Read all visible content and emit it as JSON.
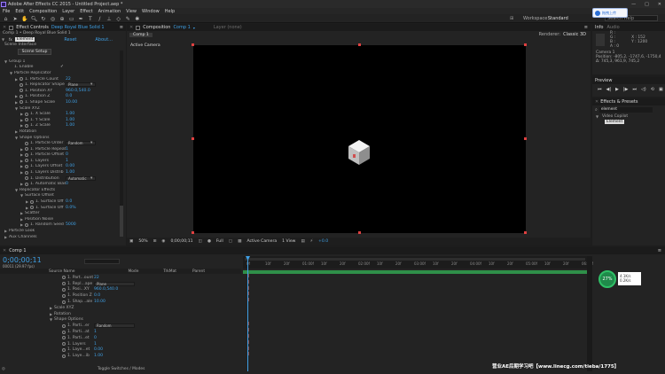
{
  "window": {
    "title": "Adobe After Effects CC 2015 - Untitled Project.aep *"
  },
  "menu": [
    "File",
    "Edit",
    "Composition",
    "Layer",
    "Effect",
    "Animation",
    "View",
    "Window",
    "Help"
  ],
  "workspace": {
    "label": "Workspace:",
    "value": "Standard"
  },
  "search_help": {
    "placeholder": "Search Help"
  },
  "baidu_popup": "拖拽上传",
  "effect_controls": {
    "tab_label": "Effect Controls",
    "tab_layer": "Deep Royal Blue Solid 1",
    "breadcrumb": "Comp 1 • Deep Royal Blue Solid 1",
    "effect_name": "Element",
    "reset": "Reset",
    "about": "About...",
    "scene_interface": "Scene Interface",
    "scene_setup": "Scene Setup",
    "rows": [
      {
        "indent": 0,
        "tri": "open",
        "label": "Group 1"
      },
      {
        "indent": 1,
        "tri": "",
        "label": "1. Enable",
        "value": "✓",
        "vtype": "check"
      },
      {
        "indent": 1,
        "tri": "open",
        "label": "Particle Replicator"
      },
      {
        "indent": 2,
        "tri": "closed",
        "stop": true,
        "label": "1. Particle Count",
        "value": "22",
        "vtype": "blue"
      },
      {
        "indent": 2,
        "tri": "",
        "stop": true,
        "label": "1. Replicator Shape",
        "value": "Plane",
        "vtype": "dd"
      },
      {
        "indent": 2,
        "tri": "",
        "stop": true,
        "label": "1. Position XY",
        "value": "960.0,540.0",
        "vtype": "blue"
      },
      {
        "indent": 2,
        "tri": "closed",
        "stop": true,
        "label": "1. Position Z",
        "value": "0.0",
        "vtype": "blue"
      },
      {
        "indent": 2,
        "tri": "closed",
        "stop": true,
        "label": "1. Shape Scale",
        "value": "10.00",
        "vtype": "blue"
      },
      {
        "indent": 2,
        "tri": "open",
        "label": "Scale XYZ"
      },
      {
        "indent": 3,
        "tri": "closed",
        "stop": true,
        "label": "1. X Scale",
        "value": "1.00",
        "vtype": "blue"
      },
      {
        "indent": 3,
        "tri": "closed",
        "stop": true,
        "label": "1. Y Scale",
        "value": "1.00",
        "vtype": "blue"
      },
      {
        "indent": 3,
        "tri": "closed",
        "stop": true,
        "label": "1. Z Scale",
        "value": "1.00",
        "vtype": "blue"
      },
      {
        "indent": 2,
        "tri": "closed",
        "label": "Rotation"
      },
      {
        "indent": 2,
        "tri": "open",
        "label": "Shape Options"
      },
      {
        "indent": 3,
        "tri": "",
        "stop": true,
        "label": "1. Particle Order",
        "value": "Random",
        "vtype": "dd"
      },
      {
        "indent": 3,
        "tri": "closed",
        "stop": true,
        "label": "1. Particle Repeat",
        "value": "1",
        "vtype": "blue"
      },
      {
        "indent": 3,
        "tri": "closed",
        "stop": true,
        "label": "1. Particle Offset",
        "value": "0",
        "vtype": "blue"
      },
      {
        "indent": 3,
        "tri": "closed",
        "stop": true,
        "label": "1. Layers",
        "value": "1",
        "vtype": "blue"
      },
      {
        "indent": 3,
        "tri": "closed",
        "stop": true,
        "label": "1. Layers Offset",
        "value": "0.00",
        "vtype": "blue"
      },
      {
        "indent": 3,
        "tri": "closed",
        "stop": true,
        "label": "1. Layers Distrib",
        "value": "1.00",
        "vtype": "blue"
      },
      {
        "indent": 3,
        "tri": "",
        "stop": true,
        "label": "1. Distribution",
        "value": "Automatic",
        "vtype": "dd"
      },
      {
        "indent": 3,
        "tri": "closed",
        "stop": true,
        "label": "1. Automatic Bias",
        "value": "0",
        "vtype": "blue"
      },
      {
        "indent": 2,
        "tri": "open",
        "label": "Replicator Effects"
      },
      {
        "indent": 3,
        "tri": "open",
        "label": "Surface Offset"
      },
      {
        "indent": 4,
        "tri": "closed",
        "stop": true,
        "label": "1. Surface Off",
        "value": "0.0",
        "vtype": "blue"
      },
      {
        "indent": 4,
        "tri": "closed",
        "stop": true,
        "label": "1. Surface Off",
        "value": "0.0%",
        "vtype": "blue"
      },
      {
        "indent": 3,
        "tri": "closed",
        "label": "Scatter"
      },
      {
        "indent": 3,
        "tri": "closed",
        "label": "Position Noise"
      },
      {
        "indent": 3,
        "tri": "closed",
        "stop": true,
        "label": "1. Random Seed",
        "value": "5000",
        "vtype": "blue"
      },
      {
        "indent": 0,
        "tri": "closed",
        "label": "Particle Look"
      },
      {
        "indent": 0,
        "tri": "closed",
        "label": "Aux Channels"
      }
    ]
  },
  "composition": {
    "tab_label": "Composition",
    "tab_comp": "Comp 1",
    "layer_tab": "Layer (none)",
    "sub_tab": "Comp 1",
    "renderer_label": "Renderer:",
    "renderer": "Classic 3D",
    "camera_label": "Active Camera",
    "footer": {
      "zoom": "50%",
      "time": "0;00;00;11",
      "quality": "Full",
      "view": "Active Camera",
      "views": "1 View",
      "exposure": "+0.0"
    }
  },
  "info": {
    "tab": "Info",
    "tab2": "Audio",
    "r": "R :",
    "g": "G :",
    "b": "B :",
    "a": "A : 0",
    "x": "X : 152",
    "y": "Y : 1200",
    "camera": "Camera 1",
    "position": "Position: -805,2, -1747,6, -1750,4",
    "delta": "Δ: 745,3, 961,9, 745,2"
  },
  "preview": {
    "tab": "Preview"
  },
  "effects_presets": {
    "tab": "Effects & Presets",
    "search": "element",
    "category": "Video Copilot",
    "item": "Element"
  },
  "timeline": {
    "tab": "Comp 1",
    "timecode": "0;00;00;11",
    "fps": "00011 (29.97 fps)",
    "col_source": "Source Name",
    "col_mode": "Mode",
    "col_trkmat": "TrkMat",
    "col_parent": "Parent",
    "ruler": [
      "0f",
      "10f",
      "20f",
      "01:00f",
      "10f",
      "20f",
      "02:00f",
      "10f",
      "20f",
      "03:00f",
      "10f",
      "20f",
      "04:00f",
      "10f",
      "20f",
      "05:00f",
      "10f",
      "20f",
      "06:00f"
    ],
    "rows": [
      {
        "indent": 5,
        "label": "1. Part...ount",
        "value": "22"
      },
      {
        "indent": 5,
        "label": "1. Repl...ape",
        "value": "Plane",
        "dd": true
      },
      {
        "indent": 5,
        "label": "1. Posi...XY",
        "value": "960.0,540.0"
      },
      {
        "indent": 5,
        "label": "1. Position Z",
        "value": "0.0"
      },
      {
        "indent": 5,
        "label": "1. Shap...ale",
        "value": "10.00"
      },
      {
        "indent": 4,
        "label": "Scale XYZ",
        "value": ""
      },
      {
        "indent": 4,
        "label": "Rotation",
        "value": ""
      },
      {
        "indent": 4,
        "label": "Shape Options",
        "value": ""
      },
      {
        "indent": 5,
        "label": "1. Parti...er",
        "value": "Random",
        "dd": true
      },
      {
        "indent": 5,
        "label": "1. Parti...at",
        "value": "1"
      },
      {
        "indent": 5,
        "label": "1. Parti...et",
        "value": "0"
      },
      {
        "indent": 5,
        "label": "1. Layers",
        "value": "1"
      },
      {
        "indent": 5,
        "label": "1. Laye...et",
        "value": "0.00"
      },
      {
        "indent": 5,
        "label": "1. Laye...ib",
        "value": "1.00"
      }
    ],
    "toggle": "Toggle Switches / Modes"
  },
  "perf": {
    "percent": "27%",
    "up": "4.1K/s",
    "down": "0.2K/s"
  },
  "watermark": "营业AE后期学习吧【www.linecg.com/tieba/1775】",
  "colors": {
    "accent": "#3fa0e5",
    "keyframe": "#e07070",
    "handle": "#e04040",
    "bg": "#232323"
  }
}
